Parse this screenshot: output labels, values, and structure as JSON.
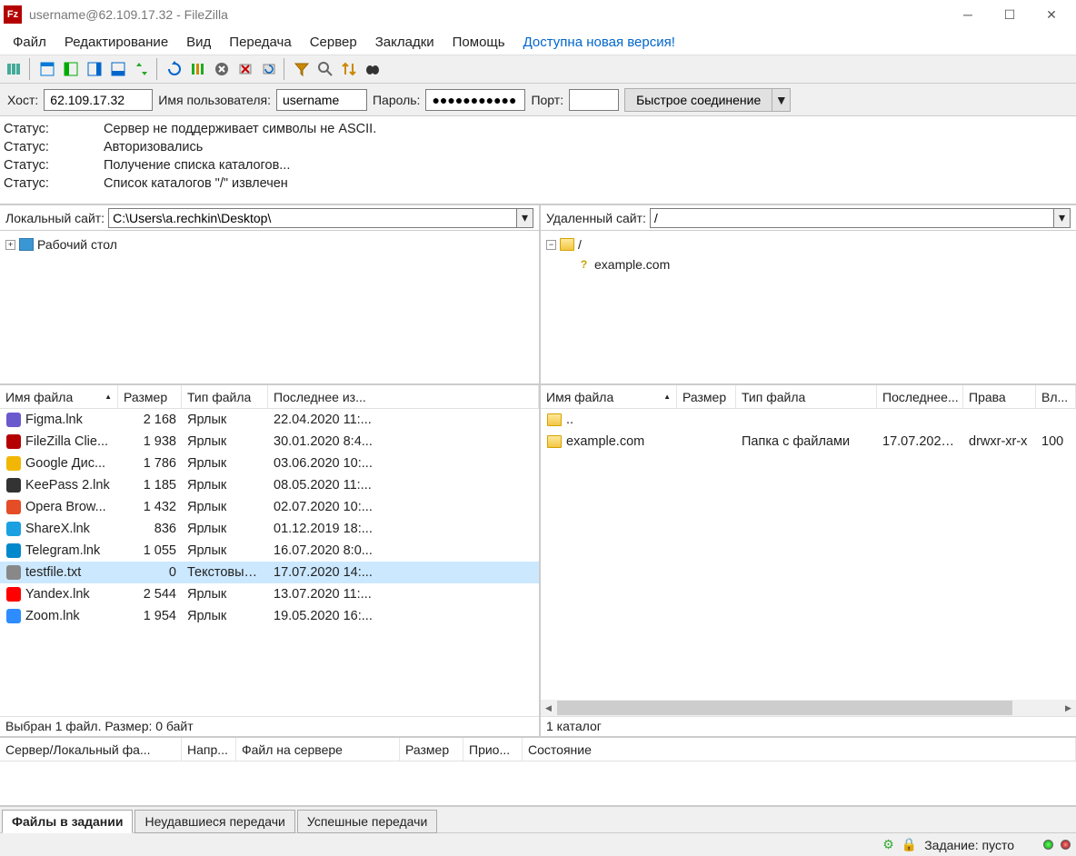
{
  "title": "username@62.109.17.32 - FileZilla",
  "menu": [
    "Файл",
    "Редактирование",
    "Вид",
    "Передача",
    "Сервер",
    "Закладки",
    "Помощь",
    "Доступна новая версия!"
  ],
  "quick": {
    "host_label": "Хост:",
    "host": "62.109.17.32",
    "user_label": "Имя пользователя:",
    "user": "username",
    "pass_label": "Пароль:",
    "pass": "●●●●●●●●●●●",
    "port_label": "Порт:",
    "port": "",
    "connect_btn": "Быстрое соединение"
  },
  "log": [
    {
      "k": "Статус:",
      "v": "Сервер не поддерживает символы не ASCII."
    },
    {
      "k": "Статус:",
      "v": "Авторизовались"
    },
    {
      "k": "Статус:",
      "v": "Получение списка каталогов..."
    },
    {
      "k": "Статус:",
      "v": "Список каталогов \"/\" извлечен"
    }
  ],
  "local": {
    "label": "Локальный сайт:",
    "path": "C:\\Users\\a.rechkin\\Desktop\\",
    "tree_root": "Рабочий стол",
    "headers": [
      "Имя файла",
      "Размер",
      "Тип файла",
      "Последнее из..."
    ],
    "files": [
      {
        "icon": "#6a5acd",
        "name": "Figma.lnk",
        "size": "2 168",
        "type": "Ярлык",
        "date": "22.04.2020 11:..."
      },
      {
        "icon": "#b40000",
        "name": "FileZilla Clie...",
        "size": "1 938",
        "type": "Ярлык",
        "date": "30.01.2020 8:4..."
      },
      {
        "icon": "#f2b705",
        "name": "Google Дис...",
        "size": "1 786",
        "type": "Ярлык",
        "date": "03.06.2020 10:..."
      },
      {
        "icon": "#333",
        "name": "KeePass 2.lnk",
        "size": "1 185",
        "type": "Ярлык",
        "date": "08.05.2020 11:..."
      },
      {
        "icon": "#e44d26",
        "name": "Opera Brow...",
        "size": "1 432",
        "type": "Ярлык",
        "date": "02.07.2020 10:..."
      },
      {
        "icon": "#1ba1e2",
        "name": "ShareX.lnk",
        "size": "836",
        "type": "Ярлык",
        "date": "01.12.2019 18:..."
      },
      {
        "icon": "#0088cc",
        "name": "Telegram.lnk",
        "size": "1 055",
        "type": "Ярлык",
        "date": "16.07.2020 8:0..."
      },
      {
        "icon": "#888",
        "name": "testfile.txt",
        "size": "0",
        "type": "Текстовый ...",
        "date": "17.07.2020 14:...",
        "selected": true
      },
      {
        "icon": "#ff0000",
        "name": "Yandex.lnk",
        "size": "2 544",
        "type": "Ярлык",
        "date": "13.07.2020 11:..."
      },
      {
        "icon": "#2d8cff",
        "name": "Zoom.lnk",
        "size": "1 954",
        "type": "Ярлык",
        "date": "19.05.2020 16:..."
      }
    ],
    "status": "Выбран 1 файл. Размер: 0 байт"
  },
  "remote": {
    "label": "Удаленный сайт:",
    "path": "/",
    "tree_root": "/",
    "tree_child": "example.com",
    "headers": [
      "Имя файла",
      "Размер",
      "Тип файла",
      "Последнее...",
      "Права",
      "Вл..."
    ],
    "files": [
      {
        "icon": "folder",
        "name": "..",
        "size": "",
        "type": "",
        "date": "",
        "perms": "",
        "owner": ""
      },
      {
        "icon": "folder",
        "name": "example.com",
        "size": "",
        "type": "Папка с файлами",
        "date": "17.07.2020 ...",
        "perms": "drwxr-xr-x",
        "owner": "100"
      }
    ],
    "status": "1 каталог"
  },
  "queue": {
    "headers": [
      "Сервер/Локальный фа...",
      "Напр...",
      "Файл на сервере",
      "Размер",
      "Прио...",
      "Состояние"
    ]
  },
  "bottom_tabs": [
    "Файлы в задании",
    "Неудавшиеся передачи",
    "Успешные передачи"
  ],
  "footer": {
    "queue": "Задание: пусто"
  }
}
